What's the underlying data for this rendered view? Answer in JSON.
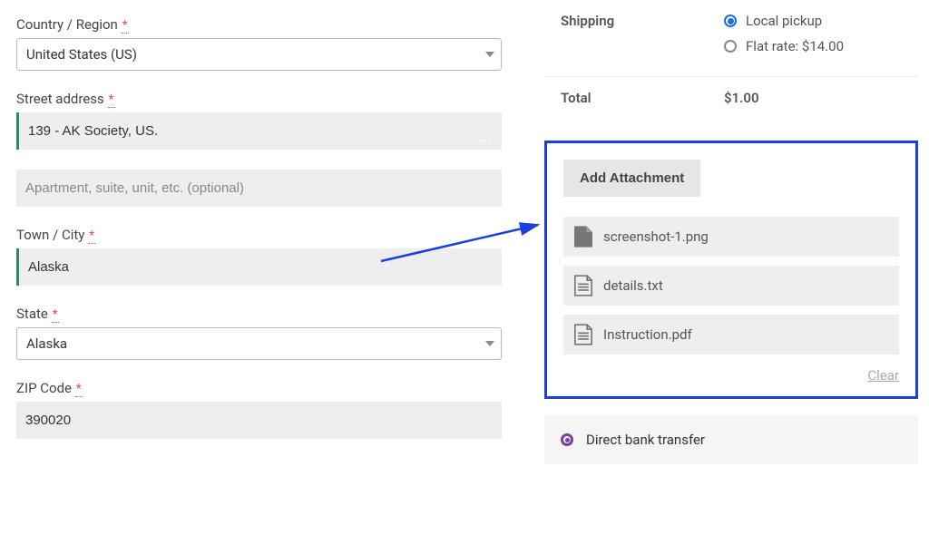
{
  "form": {
    "country": {
      "label": "Country / Region",
      "required": "*",
      "value": "United States (US)"
    },
    "street": {
      "label": "Street address",
      "required": "*",
      "line1": "139 - AK Society, US.",
      "line2_placeholder": "Apartment, suite, unit, etc. (optional)"
    },
    "city": {
      "label": "Town / City",
      "required": "*",
      "value": "Alaska"
    },
    "state": {
      "label": "State",
      "required": "*",
      "value": "Alaska"
    },
    "zip": {
      "label": "ZIP Code",
      "required": "*",
      "value": "390020"
    }
  },
  "summary": {
    "shipping_label": "Shipping",
    "shipping_options": [
      {
        "label": "Local pickup",
        "selected": true
      },
      {
        "label": "Flat rate: $14.00",
        "selected": false
      }
    ],
    "total_label": "Total",
    "total_value": "$1.00"
  },
  "attach": {
    "button": "Add Attachment",
    "files": [
      {
        "name": "screenshot-1.png",
        "type": "blank"
      },
      {
        "name": "details.txt",
        "type": "doc"
      },
      {
        "name": "Instruction.pdf",
        "type": "doc"
      }
    ],
    "clear": "Clear"
  },
  "payment": {
    "option": "Direct bank transfer"
  }
}
